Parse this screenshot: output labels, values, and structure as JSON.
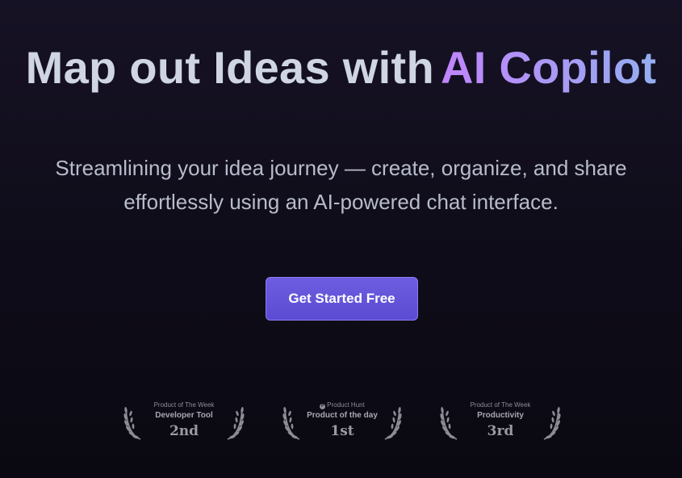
{
  "hero": {
    "title_plain": "Map out Ideas with",
    "title_highlight": "AI Copilot",
    "subtitle": "Streamlining your idea journey — create, organize, and share effortlessly using an AI-powered chat interface."
  },
  "cta": {
    "label": "Get Started Free"
  },
  "badges": [
    {
      "top": "Product of The Week",
      "category": "Developer Tool",
      "rank": "2nd"
    },
    {
      "top": "Product Hunt",
      "category": "Product of the day",
      "rank": "1st",
      "icon": "product-hunt-icon"
    },
    {
      "top": "Product of The Week",
      "category": "Productivity",
      "rank": "3rd"
    }
  ],
  "colors": {
    "background": "#100d1b",
    "title": "#cfd5e2",
    "highlight_start": "#c084fc",
    "highlight_end": "#93aef0",
    "cta": "#5b4bd3"
  }
}
